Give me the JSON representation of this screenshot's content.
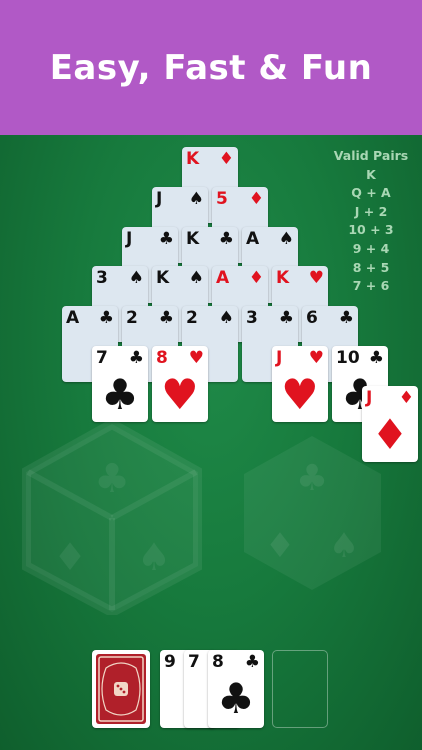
{
  "banner": {
    "title": "Easy, Fast & Fun"
  },
  "pairs_panel": {
    "title": "Valid Pairs",
    "items": [
      "K",
      "Q + A",
      "J + 2",
      "10 + 3",
      "9 + 4",
      "8 + 5",
      "7 + 6"
    ]
  },
  "colors": {
    "banner": "#b159c6",
    "felt": "#177a3d",
    "red_suit": "#e0131f",
    "black_suit": "#111111"
  },
  "pyramid": {
    "row1": [
      {
        "rank": "K",
        "suit": "♦",
        "color": "red"
      }
    ],
    "row2": [
      {
        "rank": "J",
        "suit": "♠",
        "color": "black"
      },
      {
        "rank": "5",
        "suit": "♦",
        "color": "red"
      }
    ],
    "row3": [
      {
        "rank": "J",
        "suit": "♣",
        "color": "black"
      },
      {
        "rank": "K",
        "suit": "♣",
        "color": "black"
      },
      {
        "rank": "A",
        "suit": "♠",
        "color": "black"
      }
    ],
    "row4": [
      {
        "rank": "3",
        "suit": "♠",
        "color": "black"
      },
      {
        "rank": "K",
        "suit": "♠",
        "color": "black"
      },
      {
        "rank": "A",
        "suit": "♦",
        "color": "red"
      },
      {
        "rank": "K",
        "suit": "♥",
        "color": "red"
      }
    ],
    "row5": [
      {
        "rank": "A",
        "suit": "♣",
        "color": "black"
      },
      {
        "rank": "2",
        "suit": "♣",
        "color": "black"
      },
      {
        "rank": "2",
        "suit": "♠",
        "color": "black"
      },
      {
        "rank": "3",
        "suit": "♣",
        "color": "black"
      },
      {
        "rank": "6",
        "suit": "♣",
        "color": "black"
      }
    ],
    "row6": [
      {
        "rank": "7",
        "suit": "♣",
        "color": "black"
      },
      {
        "rank": "8",
        "suit": "♥",
        "color": "red"
      },
      {
        "rank": "J",
        "suit": "♥",
        "color": "red"
      },
      {
        "rank": "10",
        "suit": "♣",
        "color": "black"
      },
      {
        "rank": "J",
        "suit": "♦",
        "color": "red"
      }
    ]
  },
  "waste": [
    {
      "rank": "9",
      "suit": "♠",
      "color": "black"
    },
    {
      "rank": "7",
      "suit": "♠",
      "color": "black"
    },
    {
      "rank": "8",
      "suit": "♣",
      "color": "black"
    }
  ],
  "icons": {
    "deck": "card-back-icon",
    "dice": "dice-watermark-icon"
  }
}
